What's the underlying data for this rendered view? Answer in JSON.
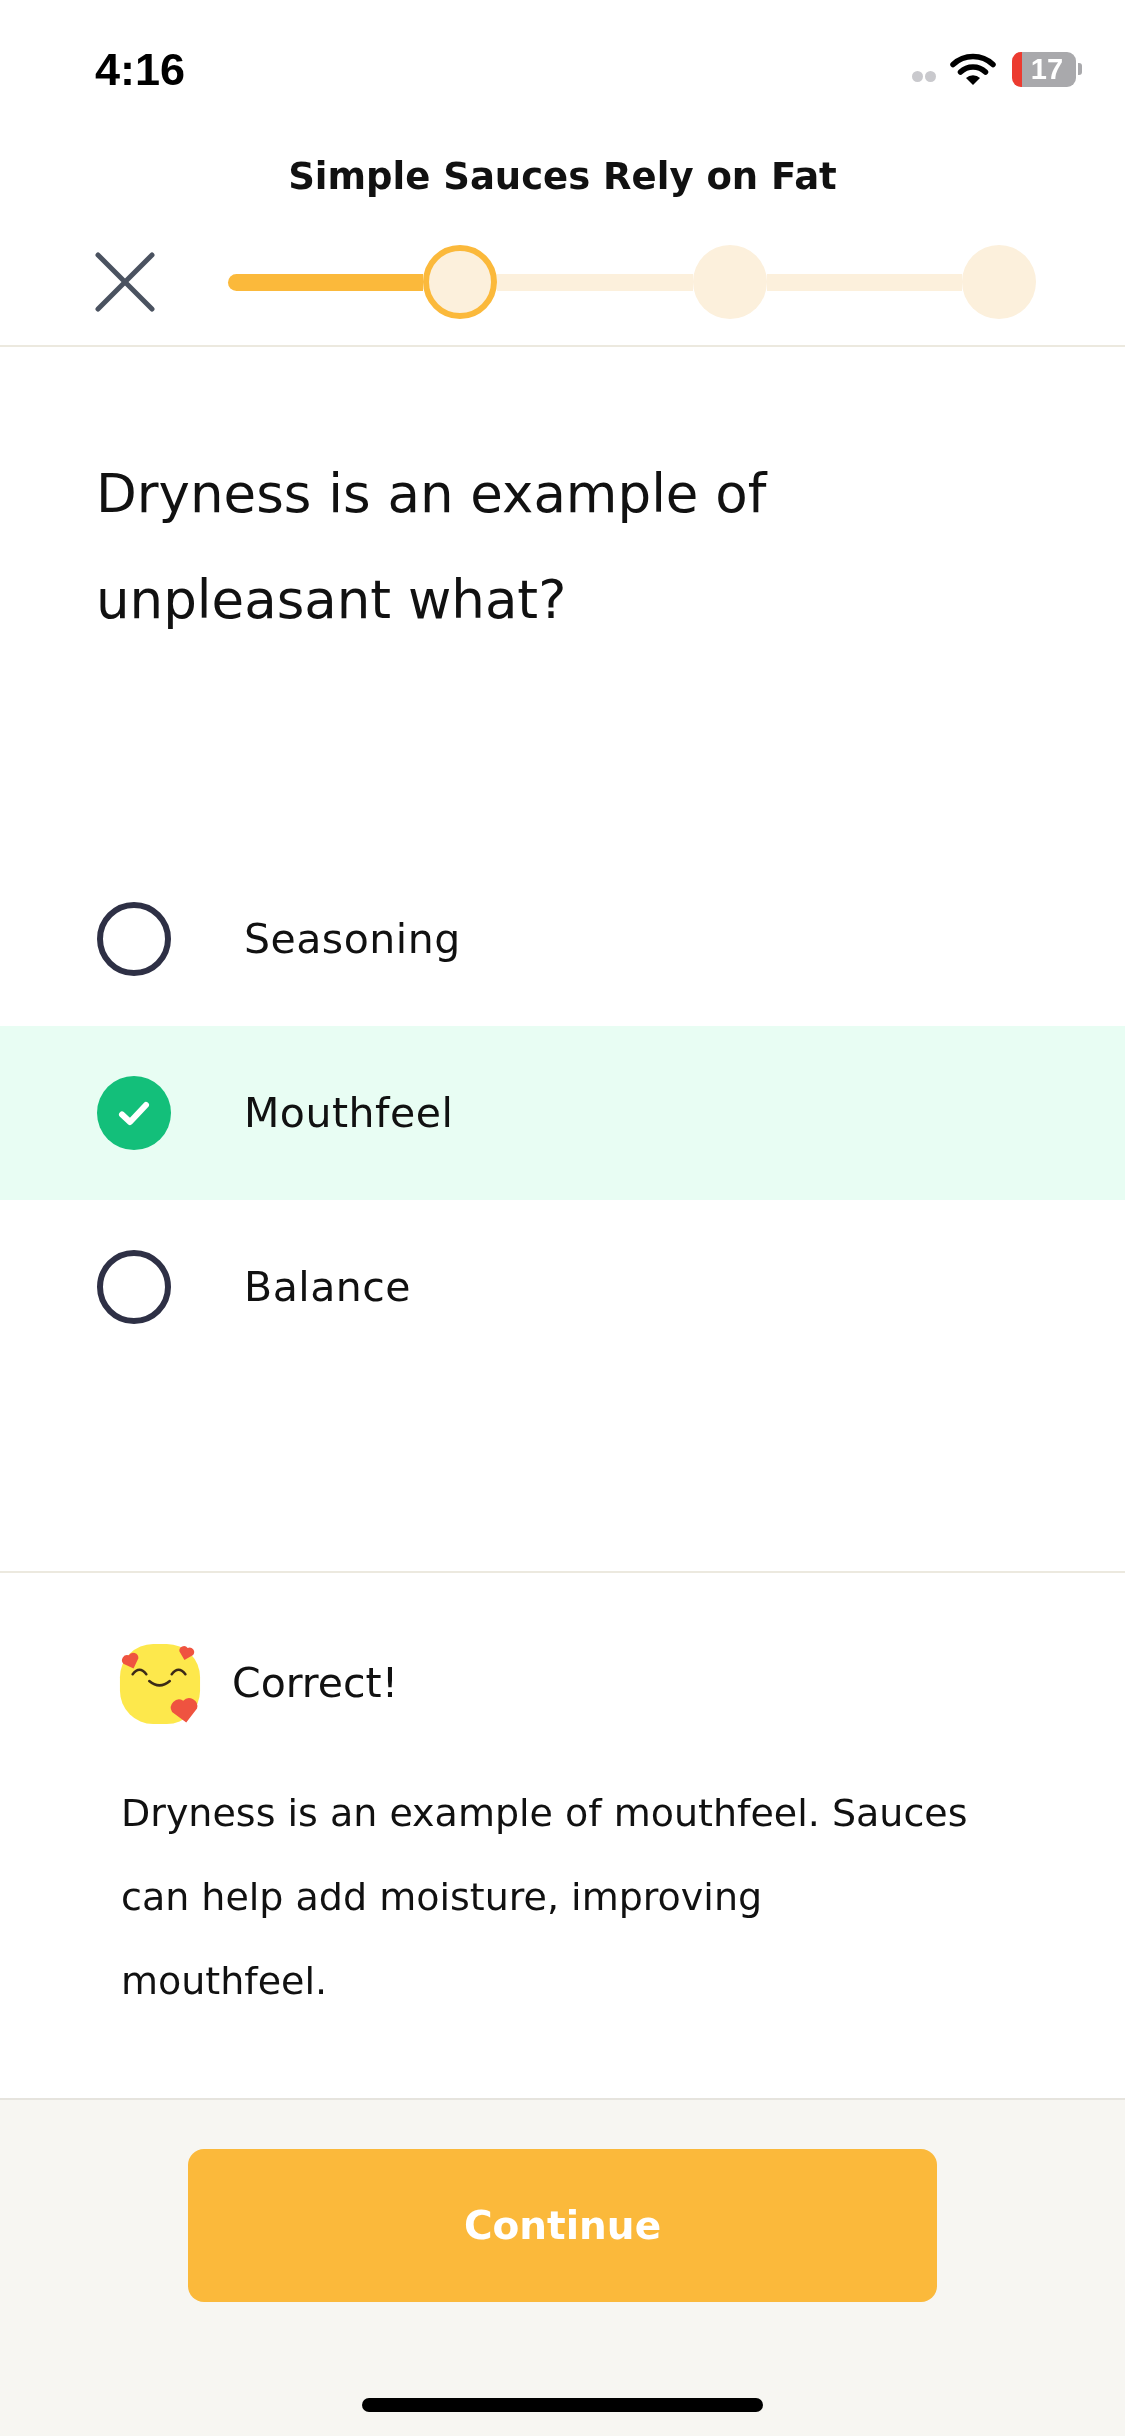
{
  "status_bar": {
    "time": "4:16",
    "battery": "17"
  },
  "header": {
    "title": "Simple Sauces Rely on Fat"
  },
  "progress": {
    "steps": [
      {
        "current": true
      },
      {
        "current": false
      },
      {
        "current": false
      }
    ]
  },
  "question": "Dryness is an example of unpleasant what?",
  "options": [
    {
      "label": "Seasoning",
      "selected": false
    },
    {
      "label": "Mouthfeel",
      "selected": true
    },
    {
      "label": "Balance",
      "selected": false
    }
  ],
  "feedback": {
    "title": "Correct!",
    "text": "Dryness is an example of mouthfeel. Sauces can help add moisture, improving mouthfeel."
  },
  "buttons": {
    "continue": "Continue"
  }
}
